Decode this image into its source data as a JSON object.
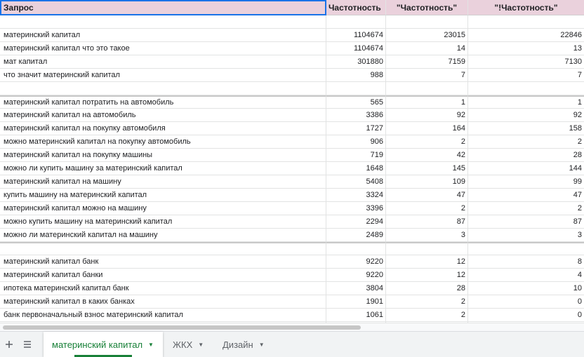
{
  "sheet": {
    "headers": [
      "Запрос",
      "Частотность",
      "\"Частотность\"",
      "\"!Частотность\""
    ],
    "rows": [
      {
        "type": "blank",
        "cells": [
          "",
          "",
          "",
          ""
        ]
      },
      {
        "type": "data",
        "cells": [
          "материнский капитал",
          "1104674",
          "23015",
          "22846"
        ]
      },
      {
        "type": "data",
        "cells": [
          "материнский капитал что это такое",
          "1104674",
          "14",
          "13"
        ]
      },
      {
        "type": "data",
        "cells": [
          "мат капитал",
          "301880",
          "7159",
          "7130"
        ]
      },
      {
        "type": "data",
        "cells": [
          "что значит материнский капитал",
          "988",
          "7",
          "7"
        ]
      },
      {
        "type": "blank",
        "cells": [
          "",
          "",
          "",
          ""
        ]
      },
      {
        "type": "data",
        "sep": true,
        "cells": [
          "материнский капитал потратить на автомобиль",
          "565",
          "1",
          "1"
        ]
      },
      {
        "type": "data",
        "cells": [
          "материнский капитал на автомобиль",
          "3386",
          "92",
          "92"
        ]
      },
      {
        "type": "data",
        "cells": [
          "материнский капитал на покупку автомобиля",
          "1727",
          "164",
          "158"
        ]
      },
      {
        "type": "data",
        "cells": [
          "можно материнский капитал на покупку автомобиль",
          "906",
          "2",
          "2"
        ]
      },
      {
        "type": "data",
        "cells": [
          "материнский капитал на покупку машины",
          "719",
          "42",
          "28"
        ]
      },
      {
        "type": "data",
        "cells": [
          "можно ли купить машину за материнский капитал",
          "1648",
          "145",
          "144"
        ]
      },
      {
        "type": "data",
        "cells": [
          "материнский капитал на машину",
          "5408",
          "109",
          "99"
        ]
      },
      {
        "type": "data",
        "cells": [
          "купить машину на материнский капитал",
          "3324",
          "47",
          "47"
        ]
      },
      {
        "type": "data",
        "cells": [
          "материнский капитал можно на машину",
          "3396",
          "2",
          "2"
        ]
      },
      {
        "type": "data",
        "cells": [
          "можно купить машину на материнский капитал",
          "2294",
          "87",
          "87"
        ]
      },
      {
        "type": "data",
        "cells": [
          "можно ли материнский капитал на машину",
          "2489",
          "3",
          "3"
        ]
      },
      {
        "type": "blank",
        "sep": true,
        "cells": [
          "",
          "",
          "",
          ""
        ]
      },
      {
        "type": "data",
        "cells": [
          "материнский капитал банк",
          "9220",
          "12",
          "8"
        ]
      },
      {
        "type": "data",
        "cells": [
          "материнский капитал банки",
          "9220",
          "12",
          "4"
        ]
      },
      {
        "type": "data",
        "cells": [
          "ипотека материнский капитал банк",
          "3804",
          "28",
          "10"
        ]
      },
      {
        "type": "data",
        "cells": [
          "материнский капитал в каких банках",
          "1901",
          "2",
          "0"
        ]
      },
      {
        "type": "data",
        "cells": [
          "банк первоначальный взнос материнский капитал",
          "1061",
          "2",
          "0"
        ]
      },
      {
        "type": "blank",
        "cells": [
          "",
          "",
          "",
          ""
        ]
      }
    ]
  },
  "tabs": [
    {
      "label": "материнский капитал",
      "active": true
    },
    {
      "label": "ЖКХ",
      "active": false
    },
    {
      "label": "Дизайн",
      "active": false
    }
  ],
  "icons": {
    "add": "plus-icon",
    "all_sheets": "menu-icon",
    "tab_menu": "triangle-down-icon"
  },
  "colors": {
    "header_bg": "#ead1dc",
    "active_tab": "#188038",
    "selection": "#1a73e8"
  }
}
